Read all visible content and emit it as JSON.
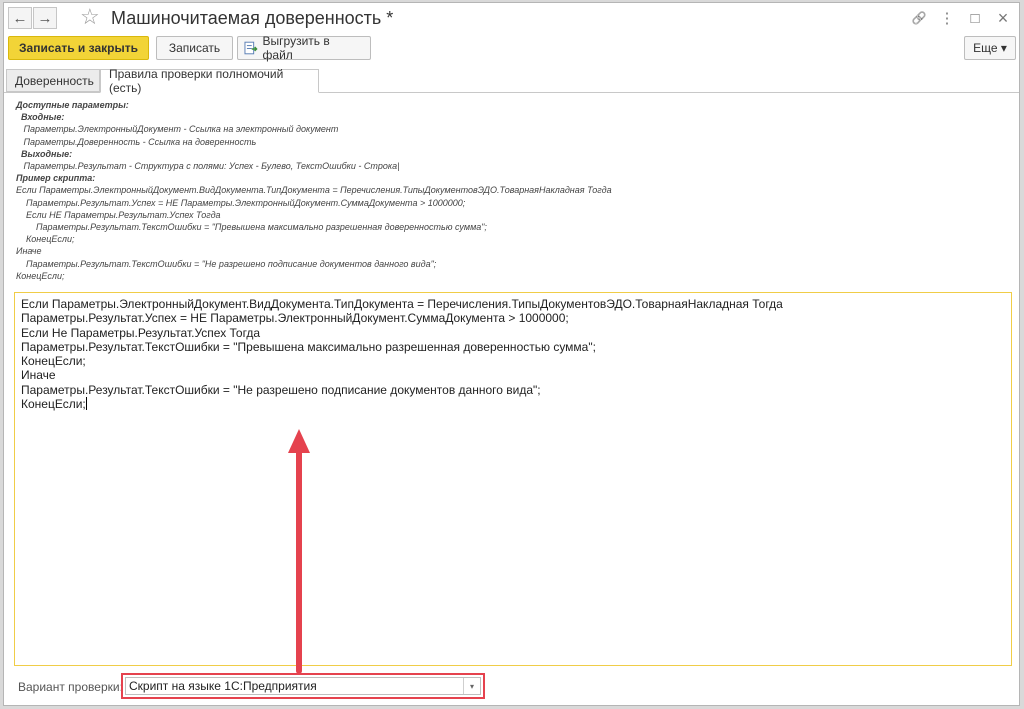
{
  "window": {
    "title": "Машиночитаемая доверенность *",
    "back_icon": "←",
    "forward_icon": "→",
    "star_icon": "☆",
    "link_icon": "🔗",
    "menu_icon": "⋮",
    "maximize_icon": "□",
    "close_icon": "×"
  },
  "toolbar": {
    "save_close_label": "Записать и закрыть",
    "save_label": "Записать",
    "export_label": "Выгрузить в файл",
    "more_label": "Еще ▾"
  },
  "tabs": [
    {
      "label": "Доверенность",
      "active": false
    },
    {
      "label": "Правила проверки полномочий (есть)",
      "active": true
    }
  ],
  "help_lines": [
    {
      "text": "Доступные параметры:",
      "bold": true
    },
    {
      "text": "  Входные:",
      "bold": true
    },
    {
      "text": "   Параметры.ЭлектронныйДокумент - Ссылка на электронный документ",
      "bold": false
    },
    {
      "text": "   Параметры.Доверенность - Ссылка на доверенность",
      "bold": false
    },
    {
      "text": "  Выходные:",
      "bold": true
    },
    {
      "text": "   Параметры.Результат - Структура с полями: Успех - Булево, ТекстОшибки - Строка|",
      "bold": false
    },
    {
      "text": "Пример скрипта:",
      "bold": true
    },
    {
      "text": "Если Параметры.ЭлектронныйДокумент.ВидДокумента.ТипДокумента = Перечисления.ТипыДокументовЭДО.ТоварнаяНакладная Тогда",
      "bold": false
    },
    {
      "text": "    Параметры.Результат.Успех = НЕ Параметры.ЭлектронныйДокумент.СуммаДокумента > 1000000;",
      "bold": false
    },
    {
      "text": "    Если НЕ Параметры.Результат.Успех Тогда",
      "bold": false
    },
    {
      "text": "        Параметры.Результат.ТекстОшибки = \"Превышена максимально разрешенная доверенностью сумма\";",
      "bold": false
    },
    {
      "text": "    КонецЕсли;",
      "bold": false
    },
    {
      "text": "Иначе",
      "bold": false
    },
    {
      "text": "    Параметры.Результат.ТекстОшибки = \"Не разрешено подписание документов данного вида\";",
      "bold": false
    },
    {
      "text": "КонецЕсли;",
      "bold": false
    }
  ],
  "editor_lines": [
    "Если Параметры.ЭлектронныйДокумент.ВидДокумента.ТипДокумента = Перечисления.ТипыДокументовЭДО.ТоварнаяНакладная Тогда",
    "Параметры.Результат.Успех = НЕ Параметры.ЭлектронныйДокумент.СуммаДокумента > 1000000;",
    "Если Не Параметры.Результат.Успех Тогда",
    "Параметры.Результат.ТекстОшибки = \"Превышена максимально разрешенная доверенностью сумма\";",
    "КонецЕсли;",
    "Иначе",
    "Параметры.Результат.ТекстОшибки = \"Не разрешено подписание документов данного вида\";",
    "КонецЕсли;"
  ],
  "variant": {
    "label": "Вариант проверки:",
    "value": "Скрипт на языке 1С:Предприятия",
    "dropdown_icon": "▾"
  },
  "colors": {
    "primary_button": "#f2d437",
    "editor_border": "#f0cd47",
    "highlight_red": "#e5424e"
  }
}
